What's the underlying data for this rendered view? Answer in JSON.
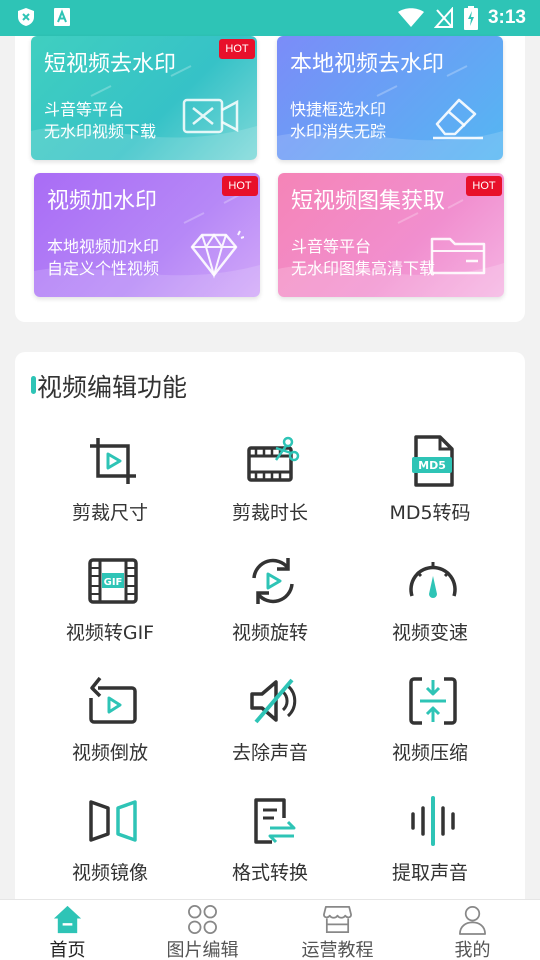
{
  "status_bar": {
    "time": "3:13"
  },
  "tool_cards": [
    {
      "title": "短视频去水印",
      "line1": "斗音等平台",
      "line2": "无水印视频下载",
      "hot": "HOT",
      "icon": "no-video-icon"
    },
    {
      "title": "本地视频去水印",
      "line1": "快捷框选水印",
      "line2": "水印消失无踪",
      "hot": "",
      "icon": "eraser-icon"
    },
    {
      "title": "视频加水印",
      "line1": "本地视频加水印",
      "line2": "自定义个性视频",
      "hot": "HOT",
      "icon": "diamond-icon"
    },
    {
      "title": "短视频图集获取",
      "line1": "斗音等平台",
      "line2": "无水印图集高清下载",
      "hot": "HOT",
      "icon": "folder-icon"
    }
  ],
  "edit_section": {
    "title": "视频编辑功能",
    "features": [
      {
        "label": "剪裁尺寸",
        "icon": "crop-icon"
      },
      {
        "label": "剪裁时长",
        "icon": "film-scissors-icon"
      },
      {
        "label": "MD5转码",
        "icon": "md5-file-icon"
      },
      {
        "label": "视频转GIF",
        "icon": "gif-film-icon"
      },
      {
        "label": "视频旋转",
        "icon": "rotate-video-icon"
      },
      {
        "label": "视频变速",
        "icon": "speedometer-icon"
      },
      {
        "label": "视频倒放",
        "icon": "reverse-video-icon"
      },
      {
        "label": "去除声音",
        "icon": "mute-icon"
      },
      {
        "label": "视频压缩",
        "icon": "compress-icon"
      },
      {
        "label": "视频镜像",
        "icon": "mirror-icon"
      },
      {
        "label": "格式转换",
        "icon": "format-convert-icon"
      },
      {
        "label": "提取声音",
        "icon": "sound-wave-icon"
      }
    ]
  },
  "bottom_nav": [
    {
      "label": "首页",
      "icon": "home-icon",
      "active": true
    },
    {
      "label": "图片编辑",
      "icon": "grid-icon",
      "active": false
    },
    {
      "label": "运营教程",
      "icon": "store-icon",
      "active": false
    },
    {
      "label": "我的",
      "icon": "user-icon",
      "active": false
    }
  ],
  "colors": {
    "accent": "#2ec4b6",
    "hot": "#e8102a",
    "icon_dark": "#333333"
  }
}
